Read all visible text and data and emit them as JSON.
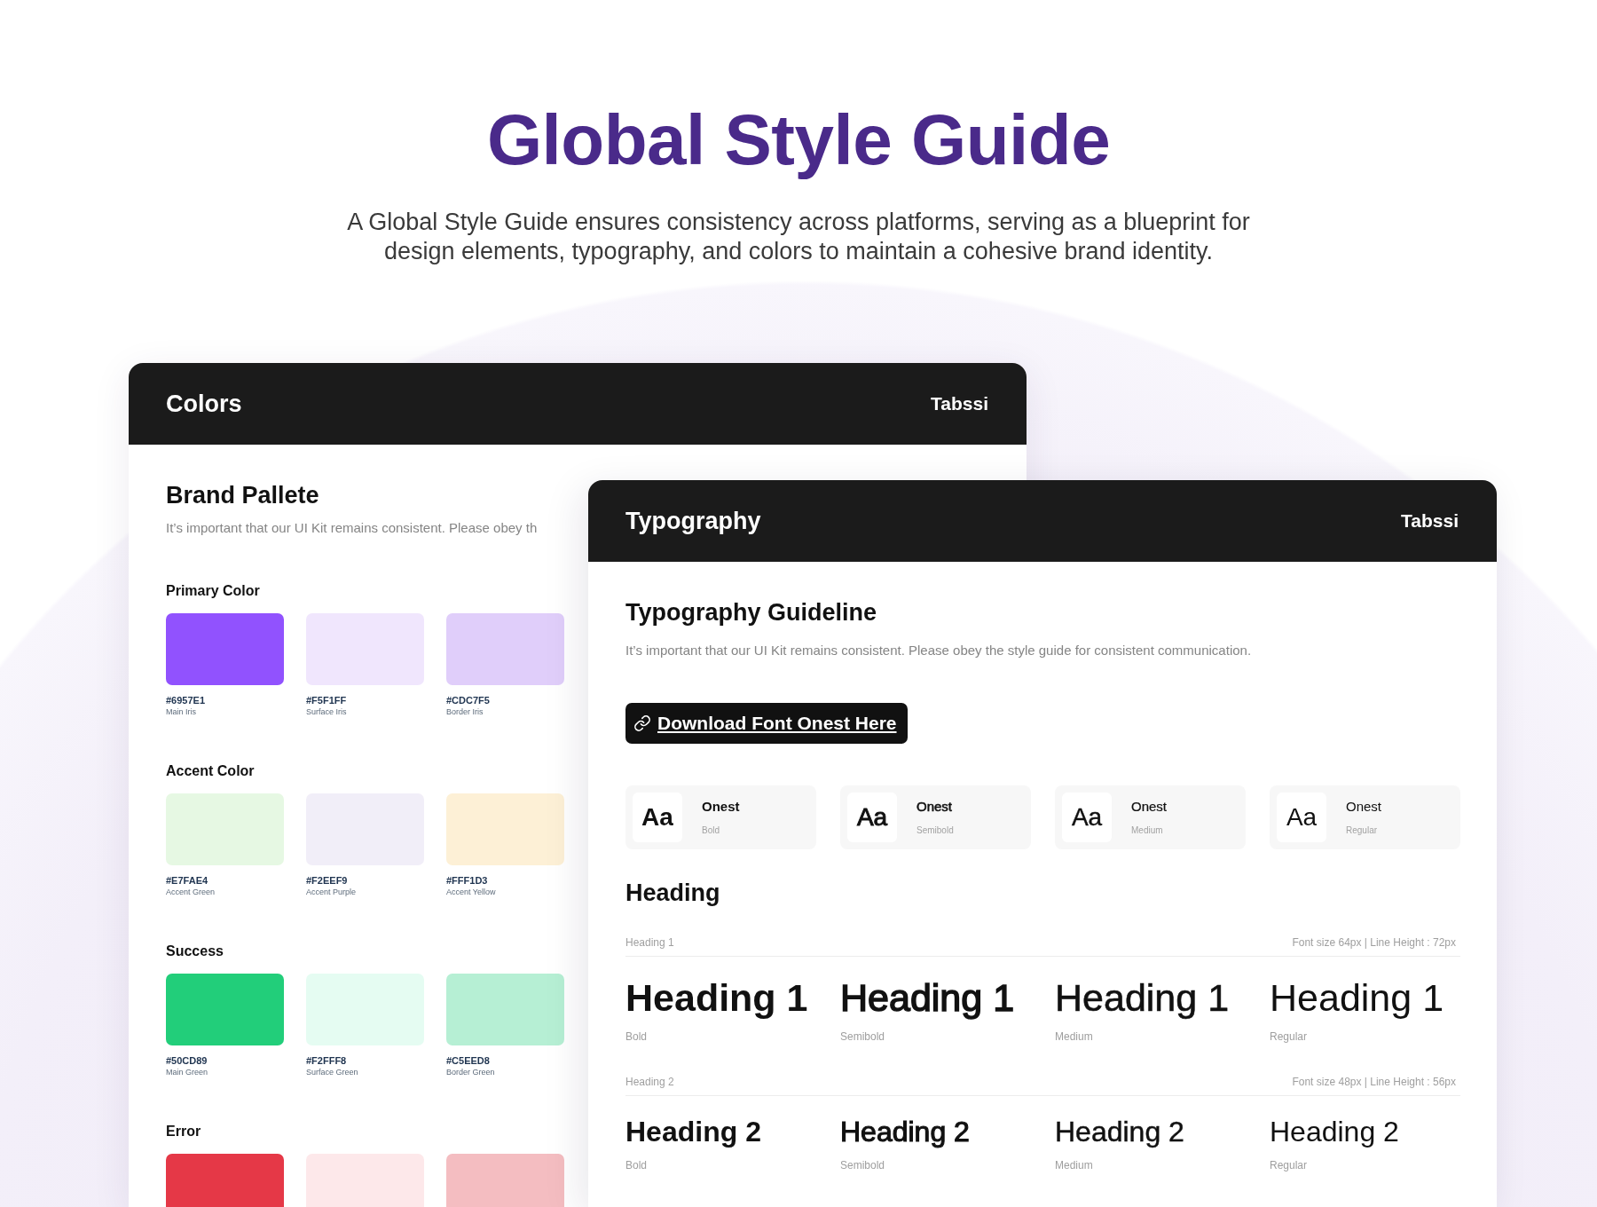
{
  "header": {
    "title": "Global Style Guide",
    "subtitle": "A Global Style Guide ensures consistency across platforms, serving as a blueprint for design elements, typography, and colors to maintain a cohesive brand identity."
  },
  "colors_panel": {
    "title": "Colors",
    "brand": "Tabssi",
    "section_title": "Brand Pallete",
    "description": "It’s important that our UI Kit remains consistent. Please obey th",
    "groups": [
      {
        "title": "Primary Color",
        "swatches": [
          {
            "color": "#9152fe",
            "hex": "#6957E1",
            "name": "Main Iris"
          },
          {
            "color": "#f0e6fd",
            "hex": "#F5F1FF",
            "name": "Surface Iris"
          },
          {
            "color": "#e0cefa",
            "hex": "#CDC7F5",
            "name": "Border Iris"
          }
        ]
      },
      {
        "title": "Accent Color",
        "swatches": [
          {
            "color": "#e6f8e3",
            "hex": "#E7FAE4",
            "name": "Accent Green"
          },
          {
            "color": "#f1eef8",
            "hex": "#F2EEF9",
            "name": "Accent Purple"
          },
          {
            "color": "#fdf0d6",
            "hex": "#FFF1D3",
            "name": "Accent Yellow"
          }
        ]
      },
      {
        "title": "Success",
        "swatches": [
          {
            "color": "#22ce7a",
            "hex": "#50CD89",
            "name": "Main Green"
          },
          {
            "color": "#e5fcf2",
            "hex": "#F2FFF8",
            "name": "Surface Green"
          },
          {
            "color": "#b6efd4",
            "hex": "#C5EED8",
            "name": "Border Green"
          }
        ]
      },
      {
        "title": "Error",
        "swatches": [
          {
            "color": "#e53847"
          },
          {
            "color": "#fde8ea"
          },
          {
            "color": "#f4bdc1"
          }
        ]
      }
    ]
  },
  "typography_panel": {
    "title": "Typography",
    "brand": "Tabssi",
    "section_title": "Typography Guideline",
    "description": "It’s important that our UI Kit remains consistent. Please obey the style guide for consistent communication.",
    "download_button": "Download Font Onest Here",
    "font_weights": [
      {
        "kind": "bold",
        "sample": "Aa",
        "family": "Onest",
        "weight": "Bold"
      },
      {
        "kind": "semibold",
        "sample": "Aa",
        "family": "Onest",
        "weight": "Semibold"
      },
      {
        "kind": "medium",
        "sample": "Aa",
        "family": "Onest",
        "weight": "Medium"
      },
      {
        "kind": "regular",
        "sample": "Aa",
        "family": "Onest",
        "weight": "Regular"
      }
    ],
    "heading_title": "Heading",
    "heading_levels": [
      {
        "kind": "heading-1",
        "label": "Heading 1",
        "spec": "Font size 64px | Line Height : 72px",
        "samples": [
          {
            "kind": "bold",
            "text": "Heading 1",
            "weight": "Bold"
          },
          {
            "kind": "semibold",
            "text": "Heading 1",
            "weight": "Semibold"
          },
          {
            "kind": "medium",
            "text": "Heading 1",
            "weight": "Medium"
          },
          {
            "kind": "regular",
            "text": "Heading 1",
            "weight": "Regular"
          }
        ]
      },
      {
        "kind": "heading-2",
        "label": "Heading 2",
        "spec": "Font size 48px | Line Height : 56px",
        "samples": [
          {
            "kind": "bold",
            "text": "Heading 2",
            "weight": "Bold"
          },
          {
            "kind": "semibold",
            "text": "Heading 2",
            "weight": "Semibold"
          },
          {
            "kind": "medium",
            "text": "Heading 2",
            "weight": "Medium"
          },
          {
            "kind": "regular",
            "text": "Heading 2",
            "weight": "Regular"
          }
        ]
      }
    ]
  }
}
